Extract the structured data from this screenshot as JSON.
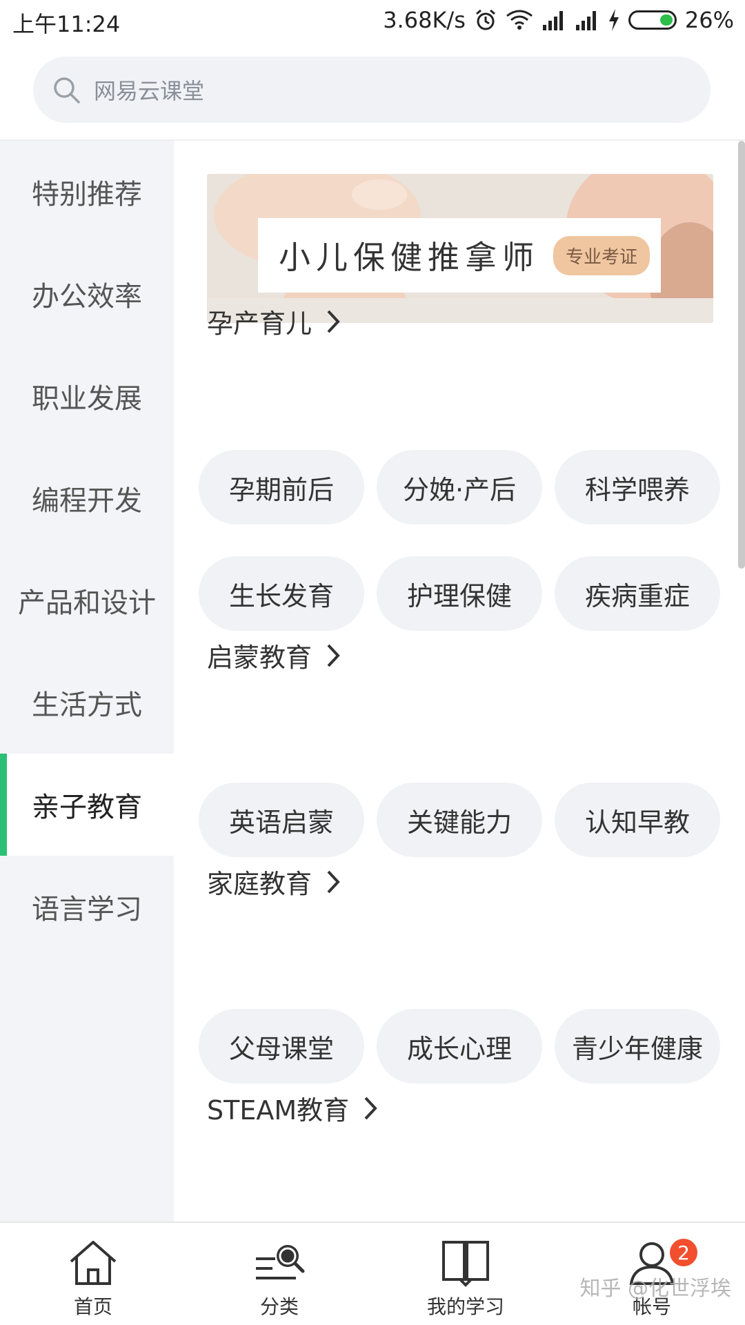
{
  "status_bar": {
    "time": "上午11:24",
    "network_speed": "3.68K/s",
    "battery": "26%",
    "icons": [
      "alarm-icon",
      "wifi-icon",
      "signal-icon",
      "signal-icon",
      "charging-icon",
      "battery-icon"
    ]
  },
  "search": {
    "placeholder": "网易云课堂",
    "icon": "search-icon"
  },
  "sidebar": {
    "items": [
      {
        "label": "特别推荐",
        "active": false
      },
      {
        "label": "办公效率",
        "active": false
      },
      {
        "label": "职业发展",
        "active": false
      },
      {
        "label": "编程开发",
        "active": false
      },
      {
        "label": "产品和设计",
        "active": false
      },
      {
        "label": "生活方式",
        "active": false
      },
      {
        "label": "亲子教育",
        "active": true
      },
      {
        "label": "语言学习",
        "active": false
      }
    ],
    "accent_color": "#2bc076"
  },
  "banner": {
    "title": "小儿保健推拿师",
    "tag": "专业考证"
  },
  "sections": [
    {
      "title": "孕产育儿",
      "chips": [
        "孕期前后",
        "分娩·产后",
        "科学喂养",
        "生长发育",
        "护理保健",
        "疾病重症"
      ]
    },
    {
      "title": "启蒙教育",
      "chips": [
        "英语启蒙",
        "关键能力",
        "认知早教"
      ]
    },
    {
      "title": "家庭教育",
      "chips": [
        "父母课堂",
        "成长心理",
        "青少年健康"
      ]
    },
    {
      "title": "STEAM教育",
      "chips": []
    }
  ],
  "bottom_nav": {
    "items": [
      {
        "label": "首页",
        "icon": "home-icon"
      },
      {
        "label": "分类",
        "icon": "category-search-icon"
      },
      {
        "label": "我的学习",
        "icon": "book-icon"
      },
      {
        "label": "帐号",
        "icon": "user-icon",
        "badge": "2"
      }
    ]
  },
  "watermark": "知乎 @化世浮埃"
}
